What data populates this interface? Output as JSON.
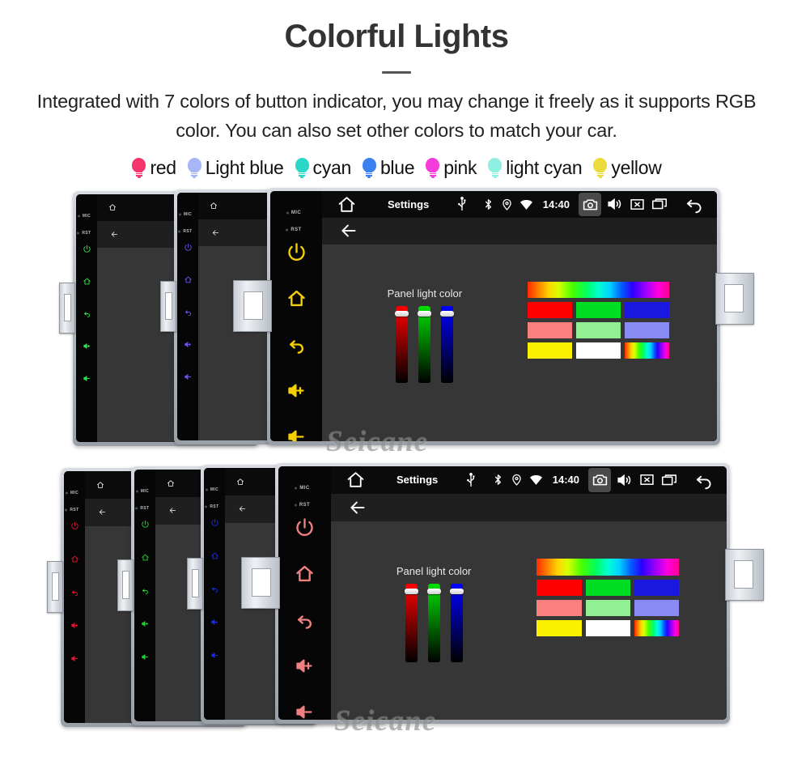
{
  "header": {
    "title": "Colorful Lights",
    "subtitle": "Integrated with 7 colors of button indicator, you may change it freely as it supports RGB color. You can also set other colors to match your car."
  },
  "legend": {
    "items": [
      {
        "label": "red",
        "color": "#f4356e",
        "icon": "bulb-icon"
      },
      {
        "label": "Light blue",
        "color": "#a6b6f7",
        "icon": "bulb-icon"
      },
      {
        "label": "cyan",
        "color": "#2ad7c8",
        "icon": "bulb-icon"
      },
      {
        "label": "blue",
        "color": "#3b82f0",
        "icon": "bulb-icon"
      },
      {
        "label": "pink",
        "color": "#f53bdc",
        "icon": "bulb-icon"
      },
      {
        "label": "light cyan",
        "color": "#8df0e0",
        "icon": "bulb-icon"
      },
      {
        "label": "yellow",
        "color": "#ebdb3c",
        "icon": "bulb-icon"
      }
    ]
  },
  "unit": {
    "side_buttons": {
      "mic_label": "MIC",
      "rst_label": "RST",
      "items": [
        {
          "name": "power-icon"
        },
        {
          "name": "home-icon"
        },
        {
          "name": "back-icon"
        },
        {
          "name": "volume-up-icon"
        },
        {
          "name": "volume-down-icon"
        }
      ]
    },
    "statusbar": {
      "home_icon": "home-icon",
      "title": "Settings",
      "usb_icon": "usb-icon",
      "bluetooth_icon": "bluetooth-icon",
      "location_icon": "location-icon",
      "wifi_icon": "wifi-icon",
      "clock": "14:40",
      "camera_icon": "camera-icon",
      "volume_icon": "speaker-icon",
      "close_icon": "close-box-icon",
      "recents_icon": "recents-icon",
      "back_icon": "back-arrow-icon"
    },
    "appbar": {
      "back_icon": "back-arrow-icon"
    },
    "panel": {
      "label": "Panel light color",
      "sliders": [
        {
          "name": "red-slider",
          "color": "#ff0000",
          "value_pct": 94
        },
        {
          "name": "green-slider",
          "color": "#00e000",
          "value_pct": 94
        },
        {
          "name": "blue-slider",
          "color": "#0000ff",
          "value_pct": 94
        }
      ],
      "swatches": {
        "spectrum_bar": "rainbow-gradient",
        "rows": [
          [
            {
              "name": "swatch-red",
              "color": "#ff0000"
            },
            {
              "name": "swatch-green",
              "color": "#00dd22"
            },
            {
              "name": "swatch-blue",
              "color": "#1a17e0"
            }
          ],
          [
            {
              "name": "swatch-salmon",
              "color": "#fa8080"
            },
            {
              "name": "swatch-lightgreen",
              "color": "#93ef93"
            },
            {
              "name": "swatch-periwinkle",
              "color": "#8a8af4"
            }
          ],
          [
            {
              "name": "swatch-yellow",
              "color": "#fbf000"
            },
            {
              "name": "swatch-white",
              "color": "#ffffff"
            },
            {
              "name": "swatch-rainbow",
              "color": "rainbow-gradient"
            }
          ]
        ]
      }
    }
  },
  "rows": {
    "top": [
      {
        "name": "unit-green",
        "accent": "#2ee04a"
      },
      {
        "name": "unit-purple",
        "accent": "#6f4df0"
      },
      {
        "name": "unit-yellow",
        "accent": "#f5d000"
      }
    ],
    "bottom": [
      {
        "name": "unit-red",
        "accent": "#e8112d"
      },
      {
        "name": "unit-green",
        "accent": "#1fcf2e"
      },
      {
        "name": "unit-blue",
        "accent": "#1b2ce0"
      },
      {
        "name": "unit-pink",
        "accent": "#f08080"
      }
    ]
  },
  "watermark": {
    "text": "Seicane"
  }
}
